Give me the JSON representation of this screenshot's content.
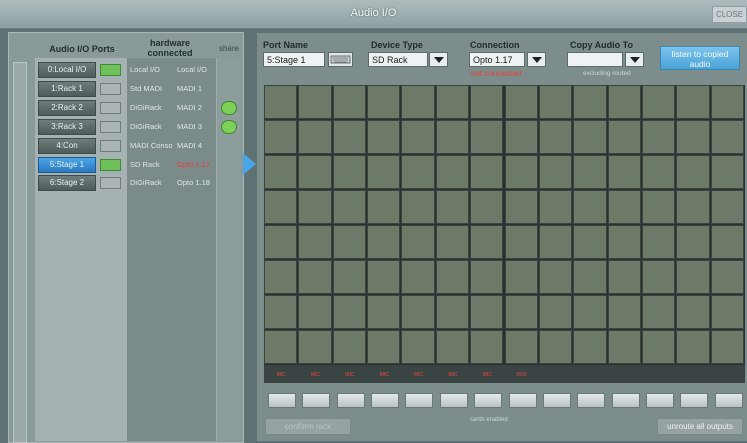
{
  "window": {
    "title": "Audio I/O",
    "close_label": "CLOSE"
  },
  "ports_panel": {
    "col_ports": "Audio I/O Ports",
    "col_hardware": "hardware connected",
    "col_share": "share",
    "rows": [
      {
        "label": "0:Local I/O",
        "active": true,
        "hw_type": "Local I/O",
        "hw_conn": "Local I/O",
        "hw_red": false,
        "share": false,
        "selected": false
      },
      {
        "label": "1:Rack 1",
        "active": false,
        "hw_type": "Std MADI",
        "hw_conn": "MADI 1",
        "hw_red": false,
        "share": false,
        "selected": false
      },
      {
        "label": "2:Rack 2",
        "active": false,
        "hw_type": "DiGiRack",
        "hw_conn": "MADI 2",
        "hw_red": false,
        "share": true,
        "selected": false
      },
      {
        "label": "3:Rack 3",
        "active": false,
        "hw_type": "DiGiRack",
        "hw_conn": "MADI 3",
        "hw_red": false,
        "share": true,
        "selected": false
      },
      {
        "label": "4:Con",
        "active": false,
        "hw_type": "MADI Conso",
        "hw_conn": "MADI 4",
        "hw_red": false,
        "share": false,
        "selected": false
      },
      {
        "label": "5:Stage 1",
        "active": true,
        "hw_type": "SD Rack",
        "hw_conn": "Opto 1.17",
        "hw_red": true,
        "share": false,
        "selected": true
      },
      {
        "label": "6:Stage 2",
        "active": false,
        "hw_type": "DiGiRack",
        "hw_conn": "Opto 1.18",
        "hw_red": false,
        "share": false,
        "selected": false
      }
    ]
  },
  "editor": {
    "port_name_label": "Port Name",
    "port_name_value": "5:Stage 1",
    "device_type_label": "Device Type",
    "device_type_value": "SD Rack",
    "connection_label": "Connection",
    "connection_value": "Opto 1.17",
    "connection_status": "not connected",
    "copy_audio_label": "Copy Audio To",
    "copy_audio_value": "",
    "copy_audio_note": "excluding routed",
    "listen_label": "listen to copied audio"
  },
  "card_grid": {
    "columns": 14,
    "rows": 8,
    "slot_labels": [
      "MIC",
      "MIC",
      "MIC",
      "MIC",
      "MIC",
      "MIC",
      "MIC",
      "DIGI",
      "",
      "",
      "",
      "",
      "",
      ""
    ]
  },
  "footer": {
    "conform_label": "conform rack",
    "cards_status": "cards enabled",
    "unroute_label": "unroute all outputs"
  },
  "colors": {
    "accent": "#4aa6e6",
    "ok": "#6fc05a",
    "error": "#e8403a"
  }
}
